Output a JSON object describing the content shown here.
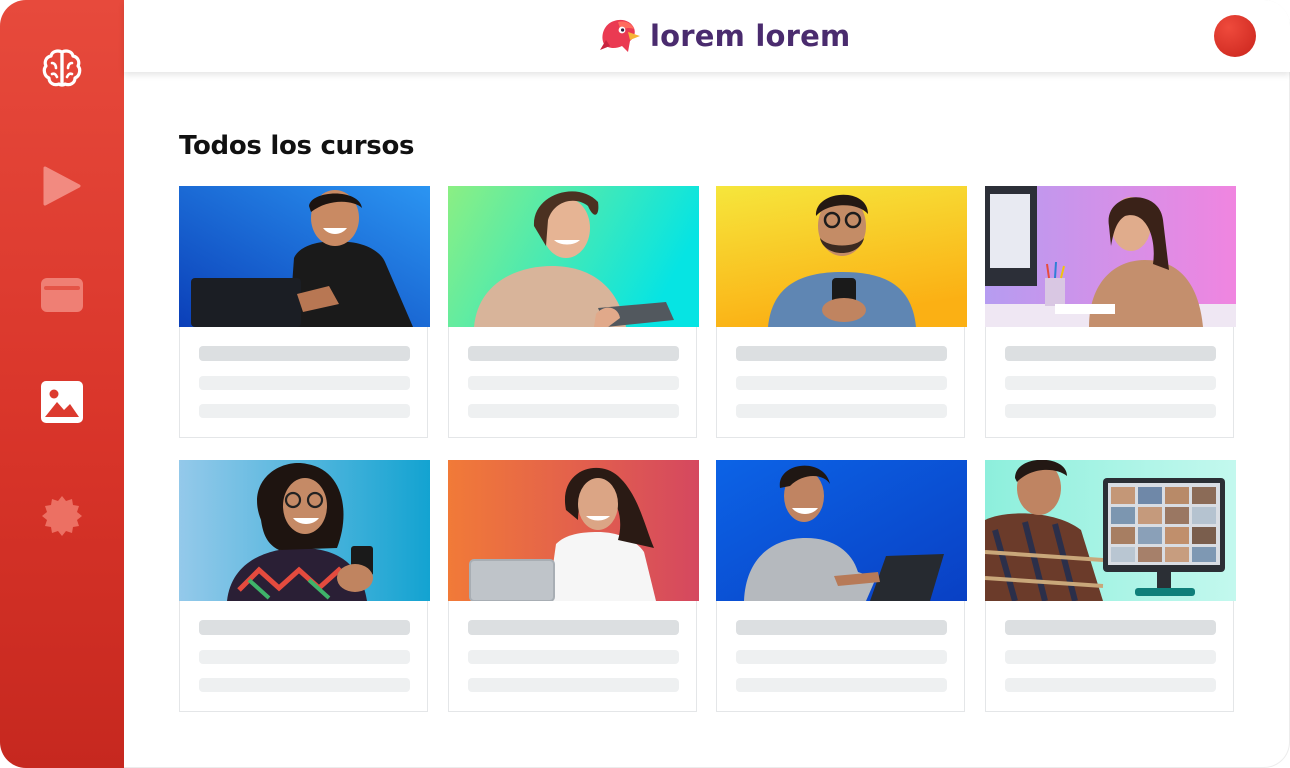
{
  "app": {
    "logo_text": "lorem lorem",
    "brand_color": "#e0392d",
    "logo_text_color": "#4a2b6e"
  },
  "sidebar": {
    "items": [
      {
        "icon": "brain-icon",
        "active": true
      },
      {
        "icon": "play-icon",
        "active": false
      },
      {
        "icon": "wallet-icon",
        "active": false
      },
      {
        "icon": "image-icon",
        "active": true
      },
      {
        "icon": "badge-icon",
        "active": false
      }
    ]
  },
  "main": {
    "title": "Todos los cursos",
    "courses": [
      {
        "image": "man-laptop-blue",
        "bg": [
          "#0f55c9",
          "#2a8ff0"
        ]
      },
      {
        "image": "woman-tablet-green",
        "bg": [
          "#7ef08a",
          "#14e3e0"
        ]
      },
      {
        "image": "man-phone-yellow",
        "bg": [
          "#f4e23a",
          "#fbb217"
        ]
      },
      {
        "image": "woman-drawing-purple",
        "bg": [
          "#b99af0",
          "#ee86e1"
        ]
      },
      {
        "image": "woman-phone-blue",
        "bg": [
          "#8fc7ea",
          "#1aa6d4"
        ]
      },
      {
        "image": "woman-laptop-orange",
        "bg": [
          "#f07a3a",
          "#d74b5e"
        ]
      },
      {
        "image": "man-laptop-blue-2",
        "bg": [
          "#0b5fe0",
          "#0a3fc6"
        ]
      },
      {
        "image": "man-videocall-teal",
        "bg": [
          "#8ff0df",
          "#bff7ec"
        ]
      }
    ]
  }
}
